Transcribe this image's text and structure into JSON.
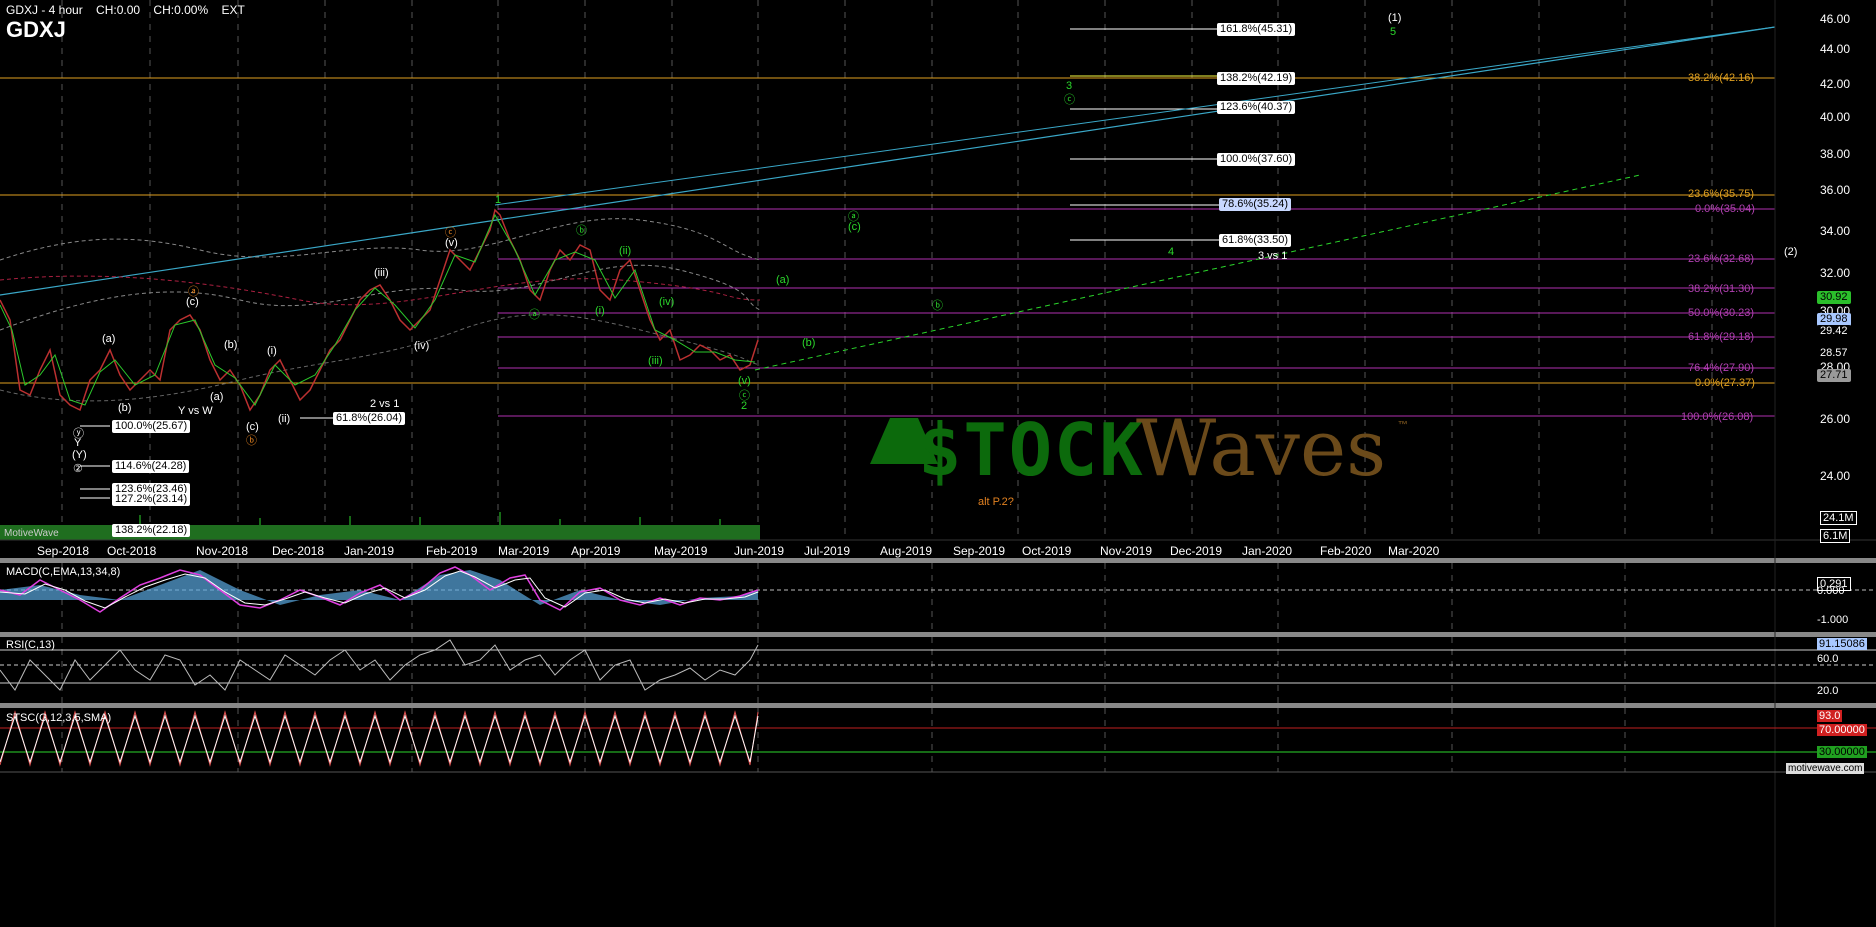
{
  "header": {
    "title_line": "GDXJ - 4 hour",
    "change1": "CH:0.00",
    "change2": "CH:0.00%",
    "session": "EXT",
    "symbol": "GDXJ",
    "vendor": "MotiveWave",
    "footer_url": "motivewave.com"
  },
  "watermark": {
    "stock_text": "$TOCK",
    "waves_text": "Waves",
    "tm": "™"
  },
  "x_axis": {
    "labels": [
      "Sep-2018",
      "Oct-2018",
      "Nov-2018",
      "Dec-2018",
      "Jan-2019",
      "Feb-2019",
      "Mar-2019",
      "Apr-2019",
      "May-2019",
      "Jun-2019",
      "Jul-2019",
      "Aug-2019",
      "Sep-2019",
      "Oct-2019",
      "Nov-2019",
      "Dec-2019",
      "Jan-2020",
      "Feb-2020",
      "Mar-2020"
    ]
  },
  "y_axis": {
    "ticks": [
      "46.00",
      "44.00",
      "42.00",
      "40.00",
      "38.00",
      "36.00",
      "34.00",
      "32.00",
      "30.00",
      "28.00",
      "26.00",
      "24.00"
    ],
    "highlights": [
      {
        "label": "30.92",
        "bg": "#2bbf2b",
        "color": "#000"
      },
      {
        "label": "29.98",
        "bg": "#a8c8ff",
        "color": "#000"
      },
      {
        "label": "29.42",
        "bg": "#000",
        "color": "#fff"
      },
      {
        "label": "28.57",
        "bg": "#000",
        "color": "#fff"
      },
      {
        "label": "27.71",
        "bg": "#9a9a9a",
        "color": "#000"
      }
    ],
    "volume_ticks": [
      "24.1M",
      "6.1M"
    ]
  },
  "fib_boxes_right": [
    {
      "label": "161.8%(45.31)",
      "style": "white"
    },
    {
      "label": "138.2%(42.19)",
      "style": "white"
    },
    {
      "label": "123.6%(40.37)",
      "style": "white"
    },
    {
      "label": "100.0%(37.60)",
      "style": "white"
    },
    {
      "label": "78.6%(35.24)",
      "style": "blue"
    },
    {
      "label": "61.8%(33.50)",
      "style": "white"
    }
  ],
  "fib_boxes_left": [
    {
      "label": "100.0%(25.67)"
    },
    {
      "label": "61.8%(26.04)"
    },
    {
      "label": "114.6%(24.28)"
    },
    {
      "label": "123.6%(23.46)"
    },
    {
      "label": "127.2%(23.14)"
    },
    {
      "label": "138.2%(22.18)"
    }
  ],
  "fib_right_edge": [
    {
      "label": "38.2%(42.16)",
      "color": "#e0a020"
    },
    {
      "label": "23.6%(35.75)",
      "color": "#e0a020"
    },
    {
      "label": "0.0%(35.04)",
      "color": "#b040b0"
    },
    {
      "label": "23.6%(32.68)",
      "color": "#b040b0"
    },
    {
      "label": "38.2%(31.30)",
      "color": "#b040b0"
    },
    {
      "label": "50.0%(30.23)",
      "color": "#b040b0"
    },
    {
      "label": "61.8%(29.18)",
      "color": "#b040b0"
    },
    {
      "label": "76.4%(27.90)",
      "color": "#b040b0"
    },
    {
      "label": "0.0%(27.37)",
      "color": "#e0a020"
    },
    {
      "label": "100.0%(26.08)",
      "color": "#b040b0"
    }
  ],
  "wave_labels": [
    {
      "t": "(1)",
      "c": "#fff"
    },
    {
      "t": "5",
      "c": "#2bd62b"
    },
    {
      "t": "(2)",
      "c": "#fff"
    },
    {
      "t": "3",
      "c": "#2bd62b"
    },
    {
      "t": "ⓒ",
      "c": "#2bd62b"
    },
    {
      "t": "1",
      "c": "#2bd62b"
    },
    {
      "t": "ⓒ",
      "c": "#e08020"
    },
    {
      "t": "(v)",
      "c": "#fff"
    },
    {
      "t": "(iii)",
      "c": "#fff"
    },
    {
      "t": "(iv)",
      "c": "#fff"
    },
    {
      "t": "ⓐ",
      "c": "#e08020"
    },
    {
      "t": "(c)",
      "c": "#fff"
    },
    {
      "t": "(a)",
      "c": "#fff"
    },
    {
      "t": "(b)",
      "c": "#fff"
    },
    {
      "t": "(i)",
      "c": "#fff"
    },
    {
      "t": "(a)",
      "c": "#fff"
    },
    {
      "t": "(b)",
      "c": "#fff"
    },
    {
      "t": "(c)",
      "c": "#fff"
    },
    {
      "t": "ⓑ",
      "c": "#e08020"
    },
    {
      "t": "(ii)",
      "c": "#fff"
    },
    {
      "t": "Y vs W",
      "c": "#fff"
    },
    {
      "t": "2 vs 1",
      "c": "#fff"
    },
    {
      "t": "Y",
      "c": "#fff"
    },
    {
      "t": "(Y)",
      "c": "#fff"
    },
    {
      "t": "②",
      "c": "#fff"
    },
    {
      "t": "ⓨ",
      "c": "#fff"
    },
    {
      "t": "ⓐ",
      "c": "#2bd62b"
    },
    {
      "t": "ⓑ",
      "c": "#2bd62b"
    },
    {
      "t": "(ii)",
      "c": "#2bd62b"
    },
    {
      "t": "(i)",
      "c": "#2bd62b"
    },
    {
      "t": "(iv)",
      "c": "#2bd62b"
    },
    {
      "t": "(iii)",
      "c": "#2bd62b"
    },
    {
      "t": "(v)",
      "c": "#2bd62b"
    },
    {
      "t": "ⓒ",
      "c": "#2bd62b"
    },
    {
      "t": "2",
      "c": "#2bd62b"
    },
    {
      "t": "ⓐ",
      "c": "#2bd62b"
    },
    {
      "t": "(c)",
      "c": "#2bd62b"
    },
    {
      "t": "(a)",
      "c": "#2bd62b"
    },
    {
      "t": "(b)",
      "c": "#2bd62b"
    },
    {
      "t": "ⓑ",
      "c": "#2bd62b"
    },
    {
      "t": "4",
      "c": "#2bd62b"
    },
    {
      "t": "3 vs 1",
      "c": "#fff"
    },
    {
      "t": "alt P.2?",
      "c": "#e08020"
    }
  ],
  "panes": {
    "macd": {
      "label": "MACD(C,EMA,13,34,8)",
      "ticks": [
        "0.291",
        "0.000",
        "-1.000"
      ]
    },
    "rsi": {
      "label": "RSI(C,13)",
      "ticks": [
        "91.15086",
        "60.0",
        "20.0"
      ]
    },
    "stsc": {
      "label": "STSC(C,12,3,5,SMA)",
      "ticks": [
        "93.0",
        "70.00000",
        "30.00000"
      ]
    }
  }
}
